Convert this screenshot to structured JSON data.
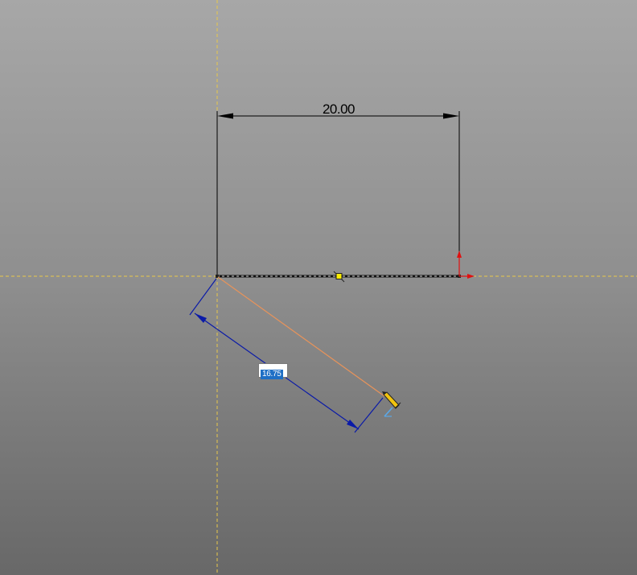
{
  "sketch": {
    "horizontal_dimension": "20.00",
    "active_dimension_input": "16.75"
  },
  "colors": {
    "axis_guide": "#e8c84a",
    "dimension_line": "#000000",
    "driving_dimension_preview": "#0a1aa8",
    "preview_line": "#e8935a",
    "sketch_line": "#111111",
    "selection_point": "#ffee00",
    "arrow_red": "#e01010",
    "input_highlight": "#1f6fc5"
  },
  "icons": [
    "line-tool-cursor-icon",
    "midpoint-marker-icon",
    "origin-arrow-icon"
  ]
}
